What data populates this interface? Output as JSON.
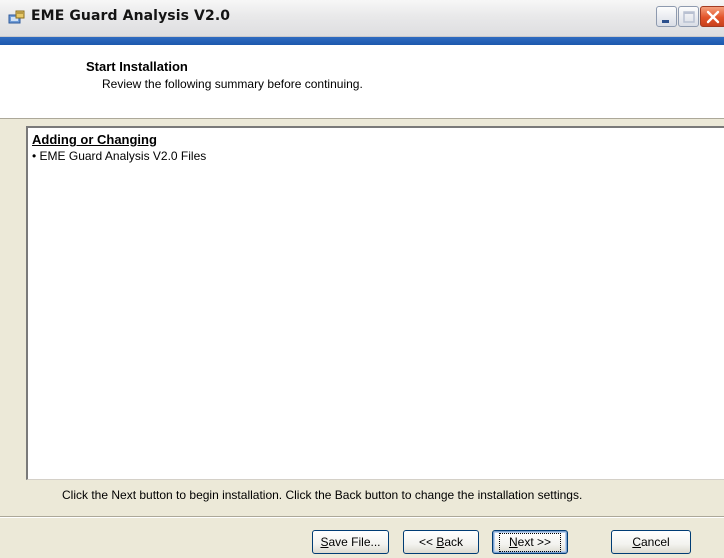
{
  "window": {
    "title": "EME Guard Analysis V2.0"
  },
  "header": {
    "title": "Start Installation",
    "subtitle": "Review the following summary before continuing."
  },
  "summary": {
    "heading": "Adding or Changing",
    "items": [
      "• EME Guard Analysis V2.0 Files"
    ]
  },
  "instruction": "Click the Next button to begin installation.  Click the Back button to change the installation settings.",
  "buttons": {
    "save": {
      "mnemonic": "S",
      "rest": "ave File..."
    },
    "back": {
      "prefix": "<< ",
      "mnemonic": "B",
      "rest": "ack"
    },
    "next": {
      "mnemonic": "N",
      "rest": "ext >>"
    },
    "cancel": {
      "mnemonic": "C",
      "rest": "ancel"
    }
  },
  "icons": {
    "app": "installer-icon",
    "minimize": "minimize-icon",
    "maximize": "maximize-icon",
    "close": "close-icon"
  },
  "colors": {
    "title_band": "#1c58ad",
    "close_button": "#e2542a",
    "dialog_bg": "#ece9d8"
  }
}
